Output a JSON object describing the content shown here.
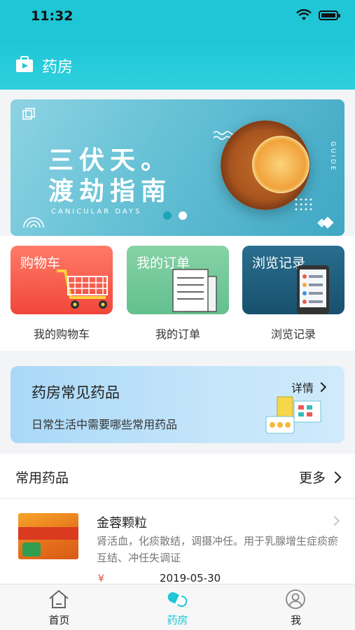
{
  "status_bar": {
    "time": "11:32"
  },
  "nav": {
    "title": "药房",
    "icon": "pharmacy-bag-icon"
  },
  "banner": {
    "title_line1": "三伏天。",
    "title_line2": "渡劫指南",
    "subtitle": "CANICULAR DAYS",
    "side_text": "GUIDE",
    "page_count": 2,
    "active_page": 2
  },
  "shortcuts": [
    {
      "tile_label": "购物车",
      "caption": "我的购物车",
      "icon": "shopping-cart-icon"
    },
    {
      "tile_label": "我的订单",
      "caption": "我的订单",
      "icon": "order-document-icon"
    },
    {
      "tile_label": "浏览记录",
      "caption": "浏览记录",
      "icon": "phone-list-icon"
    }
  ],
  "promo": {
    "title": "药房常见药品",
    "detail_label": "详情",
    "subtitle": "日常生活中需要哪些常用药品"
  },
  "common": {
    "title": "常用药品",
    "more_label": "更多",
    "items": [
      {
        "name": "金蓉颗粒",
        "description": "肾活血，化痰散结，调摄冲任。用于乳腺增生症痰瘀互结、冲任失调证",
        "price_symbol": "¥",
        "date": "2019-05-30"
      }
    ]
  },
  "tabbar": {
    "tabs": [
      {
        "label": "首页",
        "icon": "home-icon",
        "active": false
      },
      {
        "label": "药房",
        "icon": "pill-capsule-icon",
        "active": true
      },
      {
        "label": "我",
        "icon": "user-profile-icon",
        "active": false
      }
    ],
    "active_color": "#1ec6d6"
  },
  "colors": {
    "brand": "#1ec6d6",
    "price": "#e54b3c"
  }
}
